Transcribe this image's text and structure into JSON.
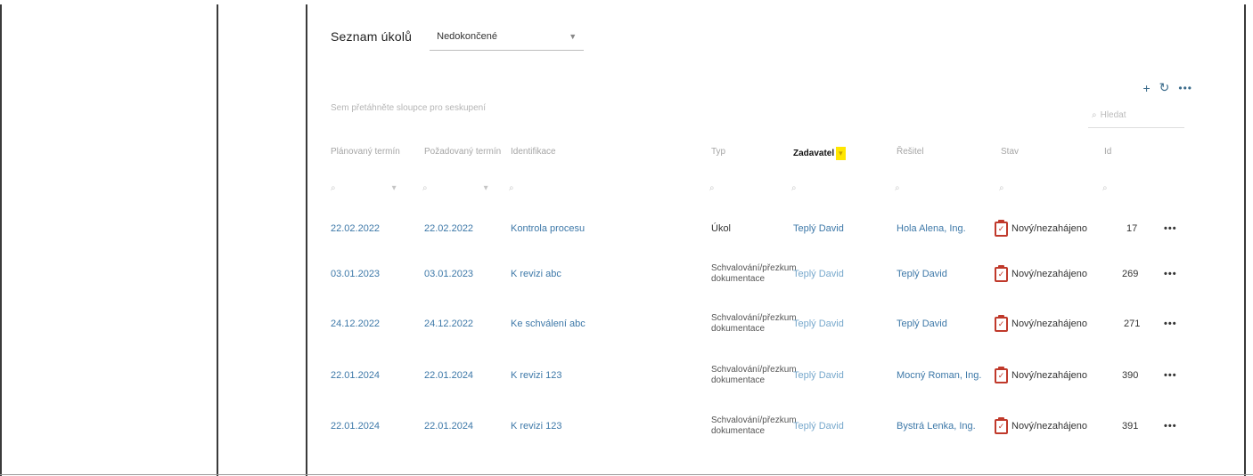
{
  "header": {
    "title": "Seznam úkolů",
    "filter_value": "Nedokončené"
  },
  "toolbar": {
    "add": "+",
    "refresh": "↻",
    "more": "•••"
  },
  "grid": {
    "group_hint": "Sem přetáhněte sloupce pro seskupení",
    "search_placeholder": "Hledat",
    "columns": [
      {
        "label": "Plánovaný termín"
      },
      {
        "label": "Požadovaný termín"
      },
      {
        "label": "Identifikace"
      },
      {
        "label": "Typ"
      },
      {
        "label": "Zadavatel",
        "sorted": true
      },
      {
        "label": "Řešitel"
      },
      {
        "label": "Stav"
      },
      {
        "label": "Id"
      }
    ],
    "sort_indicator": "▾",
    "rows": [
      {
        "planned": "22.02.2022",
        "required": "22.02.2022",
        "ident": "Kontrola procesu",
        "type": "Úkol",
        "requester": "Teplý David",
        "solver": "Hola Alena, Ing.",
        "status": "Nový/nezahájeno",
        "id": "17"
      },
      {
        "planned": "03.01.2023",
        "required": "03.01.2023",
        "ident": "K revizi abc",
        "type": "Schvalování/přezkum dokumentace",
        "requester": "Teplý David",
        "solver": "Teplý David",
        "status": "Nový/nezahájeno",
        "id": "269"
      },
      {
        "planned": "24.12.2022",
        "required": "24.12.2022",
        "ident": "Ke schválení abc",
        "type": "Schvalování/přezkum dokumentace",
        "requester": "Teplý David",
        "solver": "Teplý David",
        "status": "Nový/nezahájeno",
        "id": "271"
      },
      {
        "planned": "22.01.2024",
        "required": "22.01.2024",
        "ident": "K revizi 123",
        "type": "Schvalování/přezkum dokumentace",
        "requester": "Teplý David",
        "solver": "Mocný Roman, Ing.",
        "status": "Nový/nezahájeno",
        "id": "390"
      },
      {
        "planned": "22.01.2024",
        "required": "22.01.2024",
        "ident": "K revizi 123",
        "type": "Schvalování/přezkum dokumentace",
        "requester": "Teplý David",
        "solver": "Bystrá Lenka, Ing.",
        "status": "Nový/nezahájeno",
        "id": "391"
      }
    ],
    "row_menu": "•••"
  }
}
